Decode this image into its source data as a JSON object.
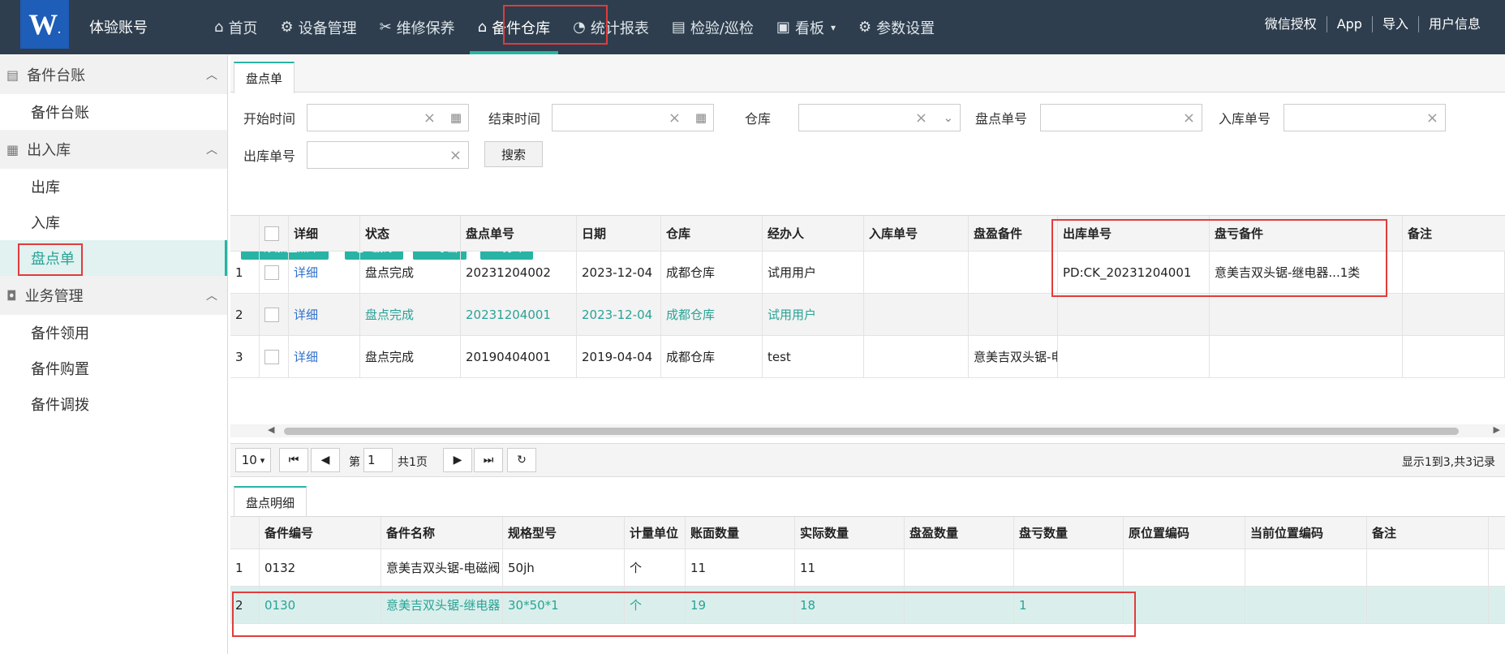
{
  "header": {
    "account": "体验账号",
    "nav": [
      {
        "icon": "⌂",
        "label": "首页"
      },
      {
        "icon": "⚙",
        "label": "设备管理"
      },
      {
        "icon": "✂",
        "label": "维修保养"
      },
      {
        "icon": "⌂",
        "label": "备件仓库"
      },
      {
        "icon": "◔",
        "label": "统计报表"
      },
      {
        "icon": "▤",
        "label": "检验/巡检"
      },
      {
        "icon": "▣",
        "label": "看板"
      },
      {
        "icon": "⚙",
        "label": "参数设置"
      }
    ],
    "right": [
      "微信授权",
      "App",
      "导入",
      "用户信息"
    ]
  },
  "sidebar": {
    "g1": "备件台账",
    "g1_items": [
      "备件台账"
    ],
    "g2": "出入库",
    "g2_items": [
      "出库",
      "入库",
      "盘点单"
    ],
    "g3": "业务管理",
    "g3_items": [
      "备件领用",
      "备件购置",
      "备件调拨"
    ]
  },
  "tab_main": "盘点单",
  "filters": {
    "start": "开始时间",
    "end": "结束时间",
    "warehouse": "仓库",
    "check_no": "盘点单号",
    "in_no": "入库单号",
    "out_no": "出库单号",
    "search": "搜索"
  },
  "actions": [
    "添加盘点单",
    "删除",
    "导出",
    "打印"
  ],
  "grid1": {
    "headers": [
      "详细",
      "状态",
      "盘点单号",
      "日期",
      "仓库",
      "经办人",
      "入库单号",
      "盘盈备件",
      "出库单号",
      "盘亏备件",
      "备注"
    ],
    "rows": [
      [
        "1",
        "详细",
        "盘点完成",
        "20231204002",
        "2023-12-04",
        "成都仓库",
        "试用用户",
        "",
        "",
        "PD:CK_20231204001",
        "意美吉双头锯-继电器...1类",
        ""
      ],
      [
        "2",
        "详细",
        "盘点完成",
        "20231204001",
        "2023-12-04",
        "成都仓库",
        "试用用户",
        "",
        "",
        "",
        "",
        ""
      ],
      [
        "3",
        "详细",
        "盘点完成",
        "20190404001",
        "2019-04-04",
        "成都仓库",
        "test",
        "",
        "意美吉双头锯-电",
        "",
        "",
        ""
      ]
    ]
  },
  "pager": {
    "size": "10",
    "page_label": "第",
    "page": "1",
    "total_pages": "共1页",
    "summary": "显示1到3,共3记录"
  },
  "tab_detail": "盘点明细",
  "grid2": {
    "headers": [
      "备件编号",
      "备件名称",
      "规格型号",
      "计量单位",
      "账面数量",
      "实际数量",
      "盘盈数量",
      "盘亏数量",
      "原位置编码",
      "当前位置编码",
      "备注"
    ],
    "rows": [
      [
        "1",
        "0132",
        "意美吉双头锯-电磁阀",
        "50jh",
        "个",
        "11",
        "11",
        "",
        "",
        "",
        "",
        ""
      ],
      [
        "2",
        "0130",
        "意美吉双头锯-继电器",
        "30*50*1",
        "个",
        "19",
        "18",
        "",
        "1",
        "",
        "",
        ""
      ]
    ]
  }
}
